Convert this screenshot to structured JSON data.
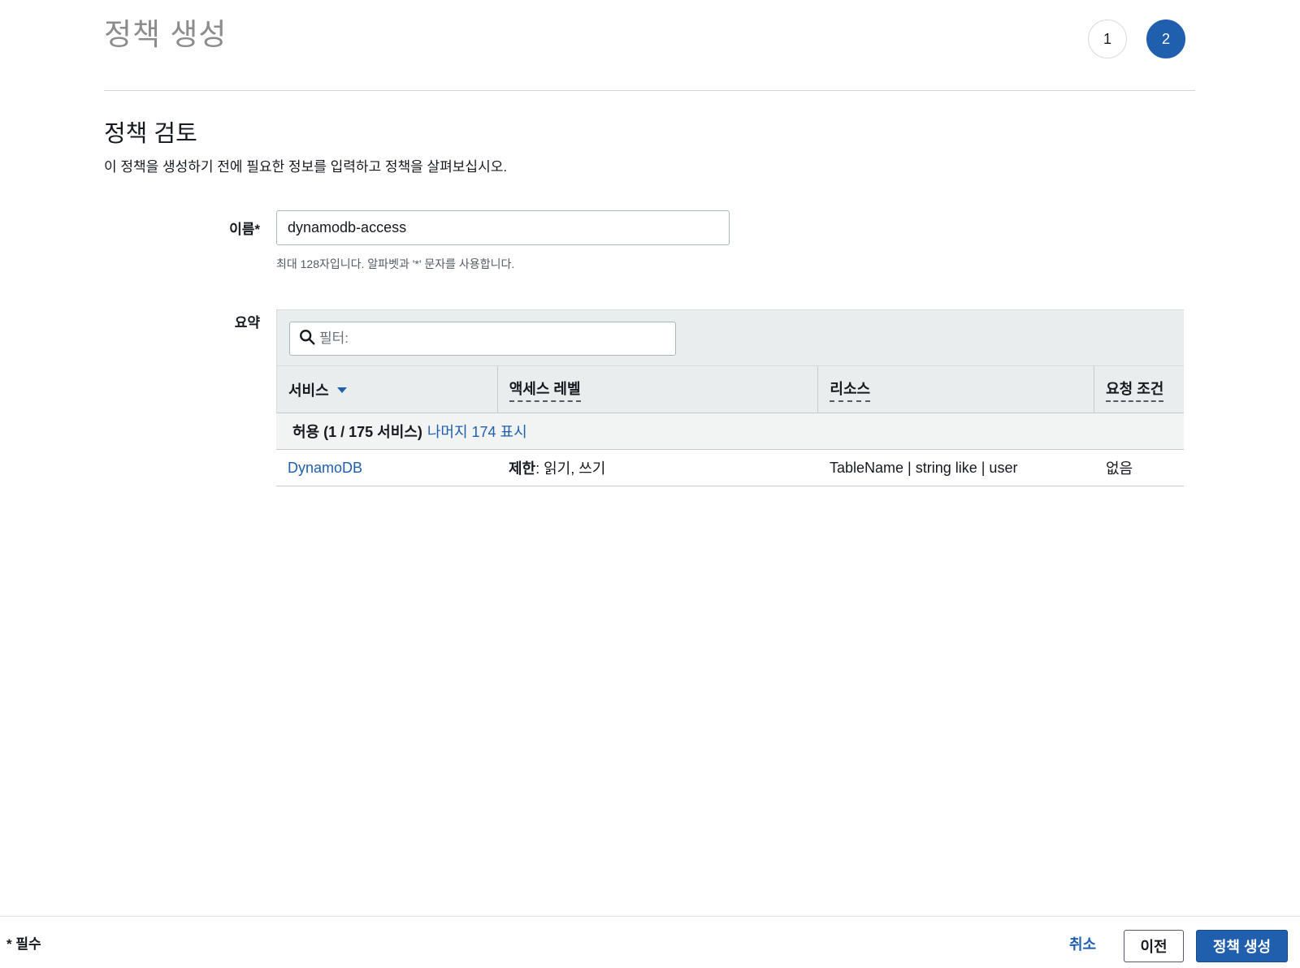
{
  "header": {
    "title": "정책 생성",
    "steps": [
      "1",
      "2"
    ]
  },
  "review": {
    "title": "정책 검토",
    "description": "이 정책을 생성하기 전에 필요한 정보를 입력하고 정책을 살펴보십시오."
  },
  "name_field": {
    "label": "이름*",
    "value": "dynamodb-access",
    "hint": "최대 128자입니다. 알파벳과 '*' 문자를 사용합니다."
  },
  "summary": {
    "label": "요약",
    "filter_placeholder": "필터:",
    "columns": [
      "서비스",
      "액세스 레벨",
      "리소스",
      "요청 조건"
    ],
    "group": {
      "label": "허용 (1 / 175 서비스)",
      "link": "나머지 174 표시"
    },
    "rows": [
      {
        "service": "DynamoDB",
        "access_prefix": "제한",
        "access_rest": ": 읽기, 쓰기",
        "resource": "TableName | string like | user",
        "condition": "없음"
      }
    ]
  },
  "footer": {
    "required_note": "* 필수",
    "cancel": "취소",
    "previous": "이전",
    "create": "정책 생성"
  },
  "colors": {
    "primary": "#1f5fae",
    "link": "#1f5fae",
    "table_header_bg": "#eaeded"
  }
}
